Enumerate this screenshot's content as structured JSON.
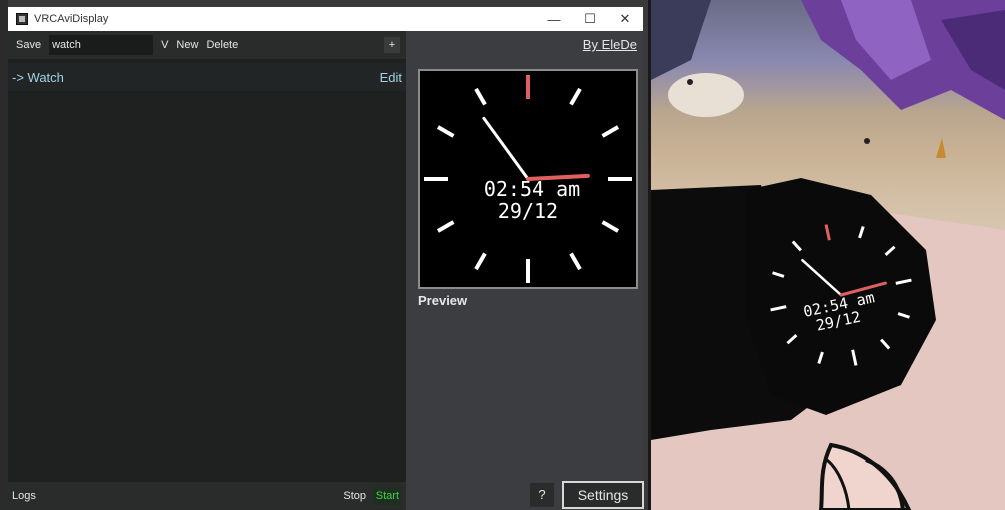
{
  "window": {
    "title": "VRCAviDisplay",
    "minimize_glyph": "—",
    "maximize_glyph": "☐",
    "close_glyph": "✕"
  },
  "toolbar": {
    "save_label": "Save",
    "profile_value": "watch",
    "dropdown_label": "V",
    "new_label": "New",
    "delete_label": "Delete",
    "add_label": "+"
  },
  "list": {
    "items": [
      {
        "label": "-> Watch",
        "edit_label": "Edit"
      }
    ]
  },
  "footer": {
    "logs_label": "Logs",
    "stop_label": "Stop",
    "start_label": "Start"
  },
  "right_panel": {
    "byline": "By EleDe",
    "preview_label": "Preview",
    "help_label": "?",
    "settings_label": "Settings"
  },
  "clock": {
    "time_text": "02:54 am",
    "date_text": "29/12",
    "hour": 2,
    "minute": 54,
    "hour_hand_color": "#e06060",
    "twelve_marker_color": "#e06060",
    "marker_color": "#ffffff"
  },
  "colors": {
    "accent_text": "#9fd3e6",
    "start_green": "#3fd04a"
  }
}
